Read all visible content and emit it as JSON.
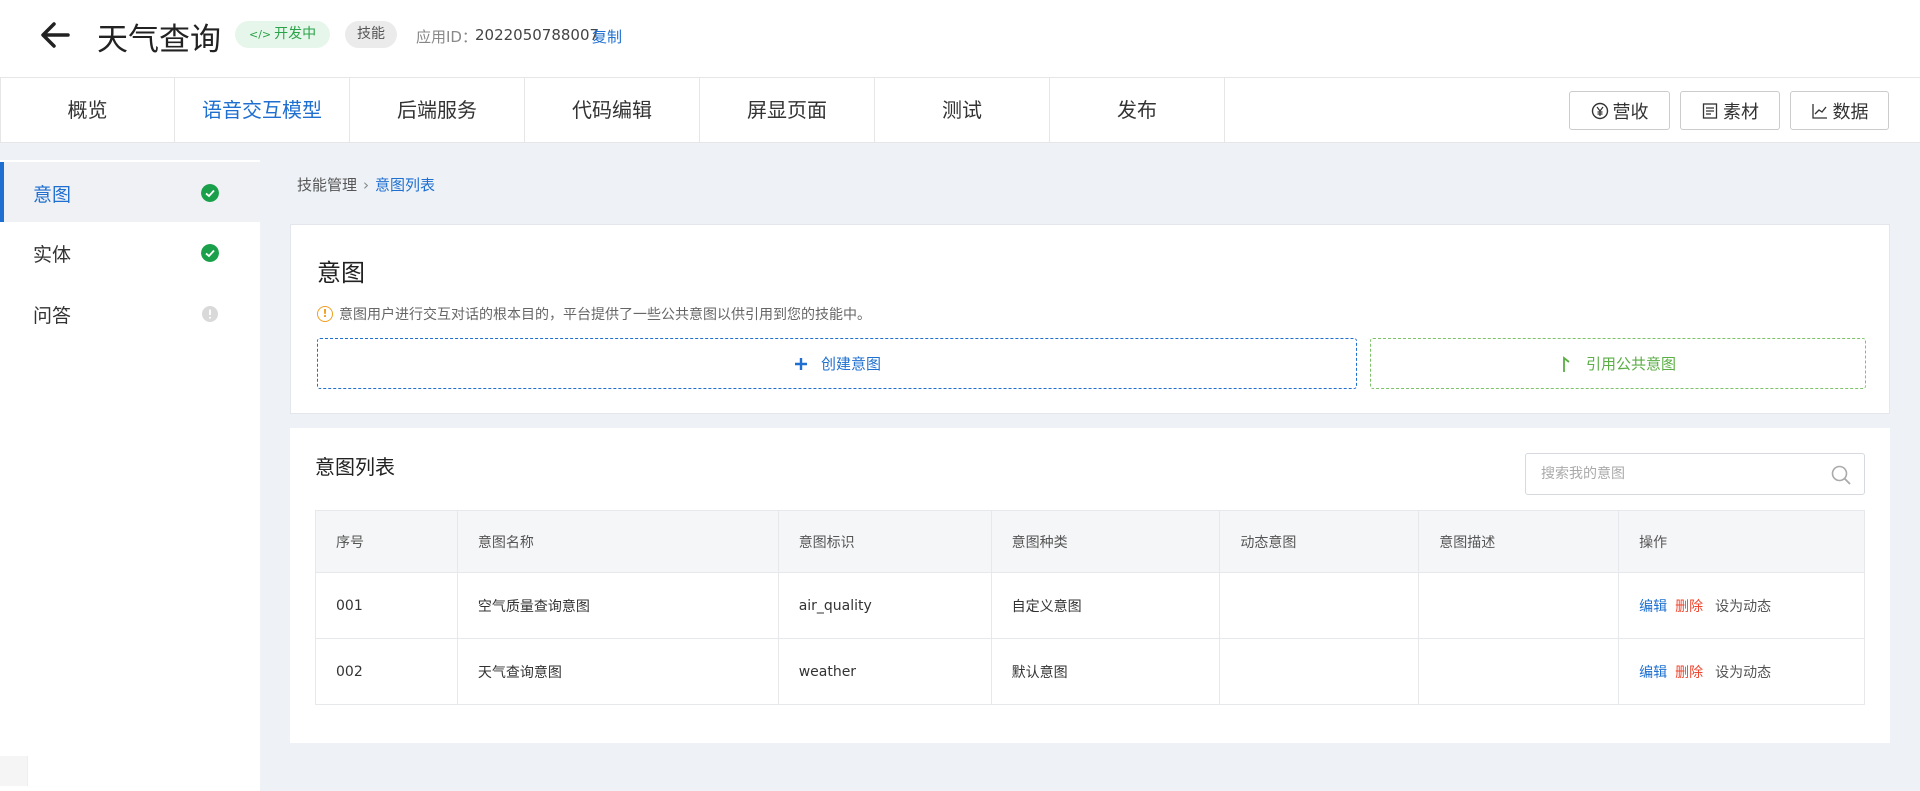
{
  "header": {
    "title": "天气查询",
    "status_badge": "开发中",
    "status_icon": "code-icon",
    "type_badge": "技能",
    "app_id_label": "应用ID：",
    "app_id_value": "2022050788007",
    "copy_label": "复制"
  },
  "tabs": [
    {
      "label": "概览",
      "active": false
    },
    {
      "label": "语音交互模型",
      "active": true
    },
    {
      "label": "后端服务",
      "active": false
    },
    {
      "label": "代码编辑",
      "active": false
    },
    {
      "label": "屏显页面",
      "active": false
    },
    {
      "label": "测试",
      "active": false
    },
    {
      "label": "发布",
      "active": false
    }
  ],
  "toolbar": {
    "revenue_label": "营收",
    "material_label": "素材",
    "data_label": "数据"
  },
  "sidebar": {
    "items": [
      {
        "label": "意图",
        "status": "done",
        "active": true
      },
      {
        "label": "实体",
        "status": "done",
        "active": false
      },
      {
        "label": "问答",
        "status": "info",
        "active": false
      }
    ]
  },
  "breadcrumb": {
    "parent": "技能管理",
    "current": "意图列表"
  },
  "intent_section": {
    "title": "意图",
    "description": "意图用户进行交互对话的根本目的，平台提供了一些公共意图以供引用到您的技能中。",
    "create_label": "创建意图",
    "reference_label": "引用公共意图"
  },
  "intent_list": {
    "title": "意图列表",
    "search_placeholder": "搜索我的意图",
    "columns": [
      "序号",
      "意图名称",
      "意图标识",
      "意图种类",
      "动态意图",
      "意图描述",
      "操作"
    ],
    "rows": [
      {
        "no": "001",
        "name": "空气质量查询意图",
        "id": "air_quality",
        "kind": "自定义意图",
        "dynamic": "",
        "desc": ""
      },
      {
        "no": "002",
        "name": "天气查询意图",
        "id": "weather",
        "kind": "默认意图",
        "dynamic": "",
        "desc": ""
      }
    ],
    "actions": {
      "edit": "编辑",
      "delete": "删除",
      "set_dynamic": "设为动态"
    }
  },
  "colors": {
    "accent": "#1e6fd0",
    "success": "#1aa04a",
    "danger": "#f0462f",
    "green_dashed": "#7cc36a"
  }
}
